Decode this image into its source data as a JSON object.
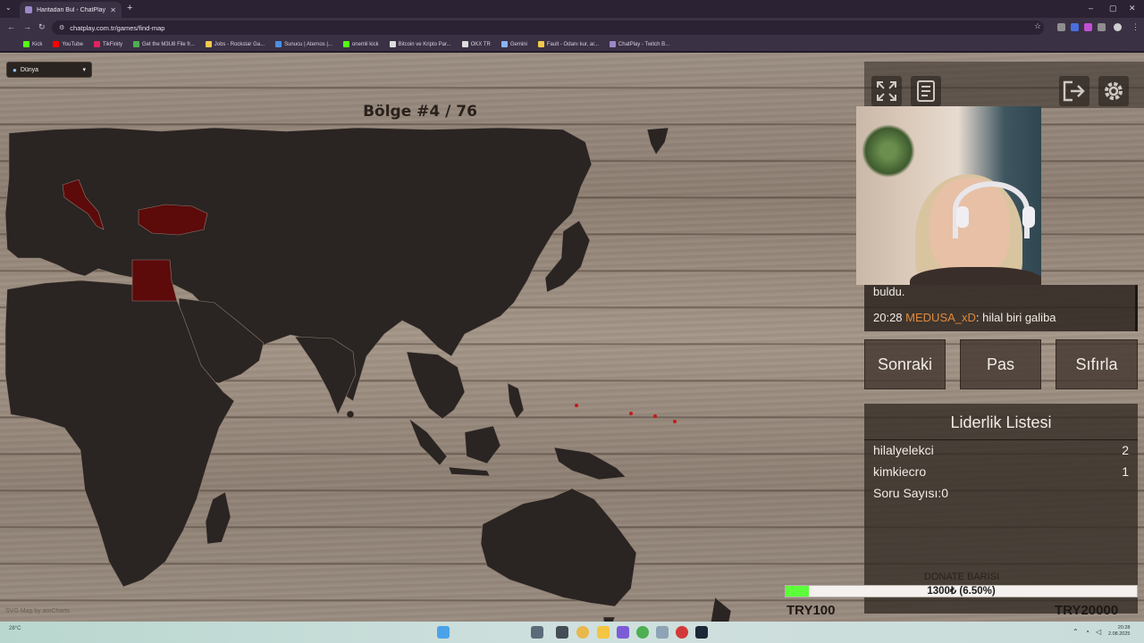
{
  "browser": {
    "tab_title": "Haritadan Bul - ChatPlay",
    "url": "chatplay.com.tr/games/find-map",
    "bookmarks": [
      {
        "label": "Kick",
        "color": "#53fc18"
      },
      {
        "label": "YouTube",
        "color": "#ff0000"
      },
      {
        "label": "TikFinity",
        "color": "#e0245e"
      },
      {
        "label": "Get the M3U8 File fr...",
        "color": "#4caf50"
      },
      {
        "label": "Jobs - Rockstar Ga...",
        "color": "#f2c94c"
      },
      {
        "label": "Sunucu | Aternos |...",
        "color": "#4a90e2"
      },
      {
        "label": "onemli kick",
        "color": "#53fc18"
      },
      {
        "label": "Bitcoin ve Kripto Par...",
        "color": "#222222"
      },
      {
        "label": "OKX TR",
        "color": "#222222"
      },
      {
        "label": "Gemini",
        "color": "#8ab4f8"
      },
      {
        "label": "Fault - Odanı kur, ar...",
        "color": "#f2c94c"
      },
      {
        "label": "ChatPlay - Twitch B...",
        "color": "#9b87c9"
      }
    ]
  },
  "game": {
    "region_select": "Dünya",
    "region_counter": "Bölge #4 / 76",
    "map_credit": "SVG Map by amCharts"
  },
  "chat": {
    "line1": "buldu.",
    "time": "20:28",
    "user": "MEDUSA_xD",
    "message": ": hilal biri galiba"
  },
  "actions": {
    "next": "Sonraki",
    "pass": "Pas",
    "reset": "Sıfırla"
  },
  "leaderboard": {
    "title": "Liderlik Listesi",
    "rows": [
      {
        "name": "hilalyelekci",
        "score": "2"
      },
      {
        "name": "kimkiecro",
        "score": "1"
      }
    ],
    "question_count_label": "Soru Sayısı:",
    "question_count": "0"
  },
  "donate": {
    "title": "DONATE BARISI",
    "progress_text": "1300₺ (6.50%)",
    "progress_fraction": 0.065,
    "min_label": "TRY100",
    "max_label": "TRY20000"
  },
  "taskbar": {
    "weather": "28°C",
    "time": "20:28",
    "date": "2.08.2025"
  },
  "colors": {
    "land": "#2a2422",
    "highlight": "#5c0a0a",
    "wood": "#9d8f83",
    "donate_fill": "#5cff3a"
  }
}
